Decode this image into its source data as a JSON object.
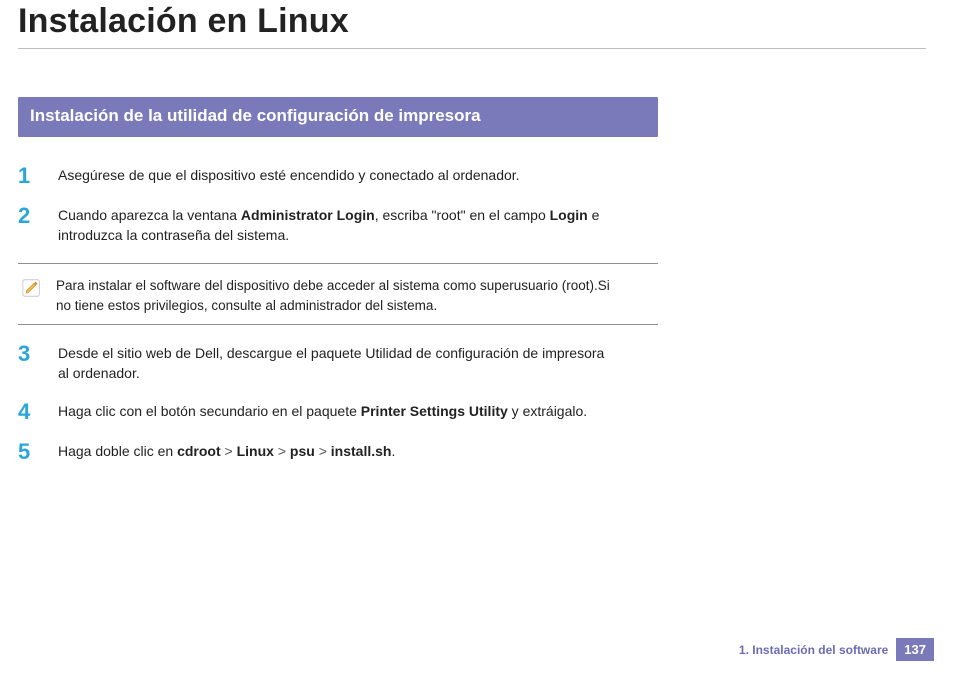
{
  "title": "Instalación en Linux",
  "section_header": "Instalación de la utilidad de configuración de impresora",
  "steps": {
    "s1": {
      "num": "1",
      "text": "Asegúrese de que el dispositivo esté encendido y conectado al ordenador."
    },
    "s2": {
      "num": "2",
      "prefix": "Cuando aparezca la ventana ",
      "b1": "Administrator Login",
      "mid1": ", escriba \"root\" en el campo ",
      "b2": "Login",
      "suffix": " e introduzca la contraseña del sistema."
    },
    "s3": {
      "num": "3",
      "text": "Desde el sitio web de Dell, descargue el paquete Utilidad de configuración de impresora al ordenador."
    },
    "s4": {
      "num": "4",
      "prefix": "Haga clic con el botón secundario en el paquete ",
      "b1": "Printer Settings Utility",
      "suffix": " y extráigalo."
    },
    "s5": {
      "num": "5",
      "prefix": "Haga doble clic en ",
      "p1": "cdroot",
      "gt": ">",
      "p2": "Linux",
      "p3": "psu",
      "p4": "install.sh",
      "period": "."
    }
  },
  "note": "Para instalar el software del dispositivo debe acceder al sistema como superusuario (root).Si no tiene estos privilegios, consulte al administrador del sistema.",
  "footer": {
    "chapter": "1.  Instalación del software",
    "page": "137"
  },
  "icons": {
    "note": "pencil-note-icon"
  }
}
